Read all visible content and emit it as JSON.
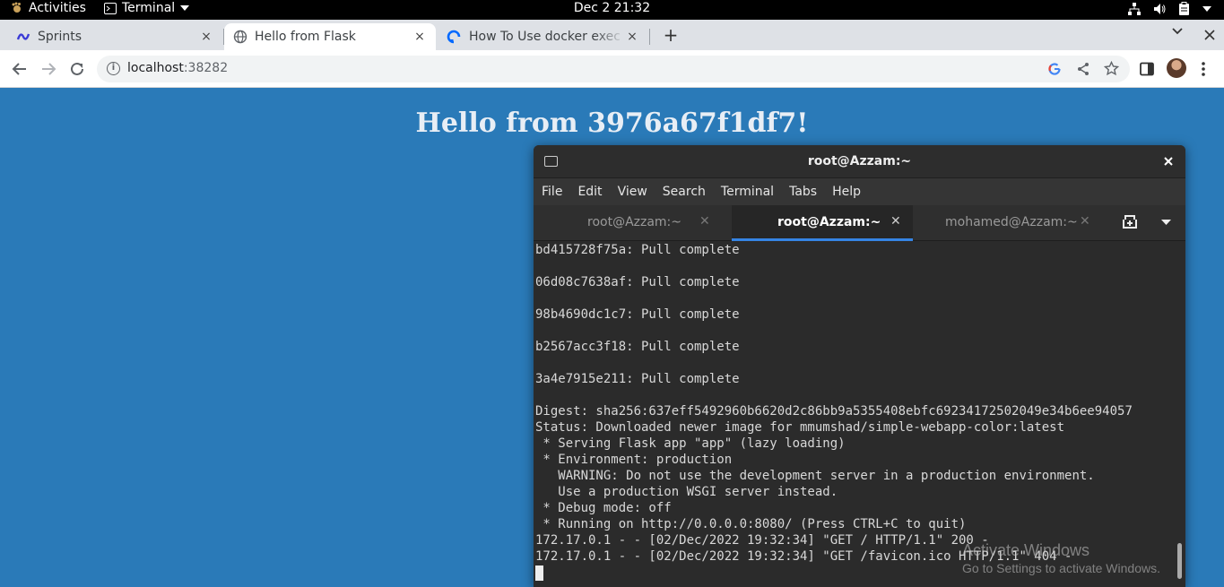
{
  "topbar": {
    "activities": "Activities",
    "app_menu": "Terminal",
    "clock": "Dec 2  21:32"
  },
  "browser": {
    "tabs": [
      {
        "title": "Sprints",
        "close": "×"
      },
      {
        "title": "Hello from Flask",
        "close": "×"
      },
      {
        "title": "How To Use docker exec to",
        "close": "×"
      }
    ],
    "new_tab": "+",
    "url_host": "localhost",
    "url_port": ":38282"
  },
  "page": {
    "heading": "Hello from 3976a67f1df7!"
  },
  "terminal": {
    "window_title": "root@Azzam:~",
    "menu": [
      "File",
      "Edit",
      "View",
      "Search",
      "Terminal",
      "Tabs",
      "Help"
    ],
    "tabs": [
      {
        "label": "root@Azzam:~",
        "active": false
      },
      {
        "label": "root@Azzam:~",
        "active": true
      },
      {
        "label": "mohamed@Azzam:~",
        "active": false
      }
    ],
    "lines": [
      "bd415728f75a: Pull complete",
      "",
      "06d08c7638af: Pull complete",
      "",
      "98b4690dc1c7: Pull complete",
      "",
      "b2567acc3f18: Pull complete",
      "",
      "3a4e7915e211: Pull complete",
      "",
      "Digest: sha256:637eff5492960b6620d2c86bb9a5355408ebfc69234172502049e34b6ee94057",
      "Status: Downloaded newer image for mmumshad/simple-webapp-color:latest",
      " * Serving Flask app \"app\" (lazy loading)",
      " * Environment: production",
      "   WARNING: Do not use the development server in a production environment.",
      "   Use a production WSGI server instead.",
      " * Debug mode: off",
      " * Running on http://0.0.0.0:8080/ (Press CTRL+C to quit)",
      "172.17.0.1 - - [02/Dec/2022 19:32:34] \"GET / HTTP/1.1\" 200 -",
      "172.17.0.1 - - [02/Dec/2022 19:32:34] \"GET /favicon.ico HTTP/1.1\" 404 -"
    ]
  },
  "watermark": {
    "line1": "Activate Windows",
    "line2": "Go to Settings to activate Windows."
  }
}
